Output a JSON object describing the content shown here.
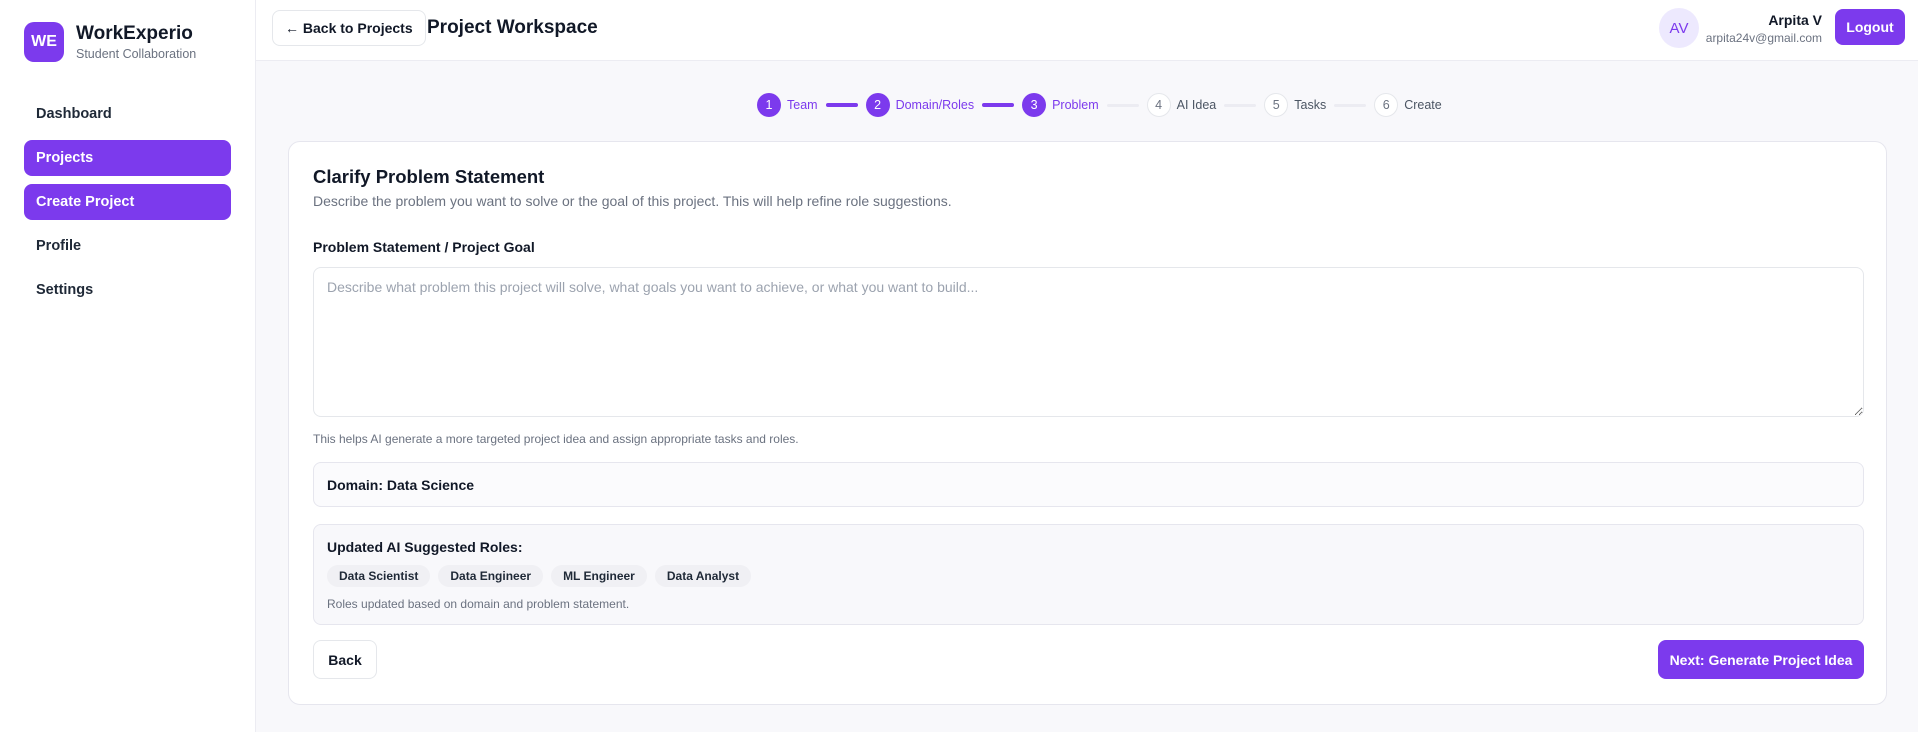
{
  "brand": {
    "logo_text": "WE",
    "name": "WorkExperio",
    "subtitle": "Student Collaboration"
  },
  "sidebar": {
    "items": [
      {
        "label": "Dashboard",
        "active": false
      },
      {
        "label": "Projects",
        "active": true
      },
      {
        "label": "Create Project",
        "active": true
      },
      {
        "label": "Profile",
        "active": false
      },
      {
        "label": "Settings",
        "active": false
      }
    ]
  },
  "header": {
    "back_label": "← Back to Projects",
    "title": "Project Workspace",
    "avatar_initials": "AV",
    "user_name": "Arpita V",
    "user_email": "arpita24v@gmail.com",
    "logout_label": "Logout"
  },
  "stepper": {
    "steps": [
      {
        "number": "1",
        "label": "Team",
        "state": "done"
      },
      {
        "number": "2",
        "label": "Domain/Roles",
        "state": "done"
      },
      {
        "number": "3",
        "label": "Problem",
        "state": "current"
      },
      {
        "number": "4",
        "label": "AI Idea",
        "state": "todo"
      },
      {
        "number": "5",
        "label": "Tasks",
        "state": "todo"
      },
      {
        "number": "6",
        "label": "Create",
        "state": "todo"
      }
    ]
  },
  "card": {
    "title": "Clarify Problem Statement",
    "description": "Describe the problem you want to solve or the goal of this project. This will help refine role suggestions.",
    "field_label": "Problem Statement / Project Goal",
    "textarea_value": "",
    "textarea_placeholder": "Describe what problem this project will solve, what goals you want to achieve, or what you want to build...",
    "helper_text": "This helps AI generate a more targeted project idea and assign appropriate tasks and roles.",
    "domain_text": "Domain: Data Science",
    "roles_title": "Updated AI Suggested Roles:",
    "roles": [
      "Data Scientist",
      "Data Engineer",
      "ML Engineer",
      "Data Analyst"
    ],
    "roles_note": "Roles updated based on domain and problem statement.",
    "back_button": "Back",
    "next_button": "Next: Generate Project Idea"
  },
  "colors": {
    "accent": "#7c3aed",
    "accent_light": "#ede9fe",
    "background": "#f8f8fb"
  }
}
